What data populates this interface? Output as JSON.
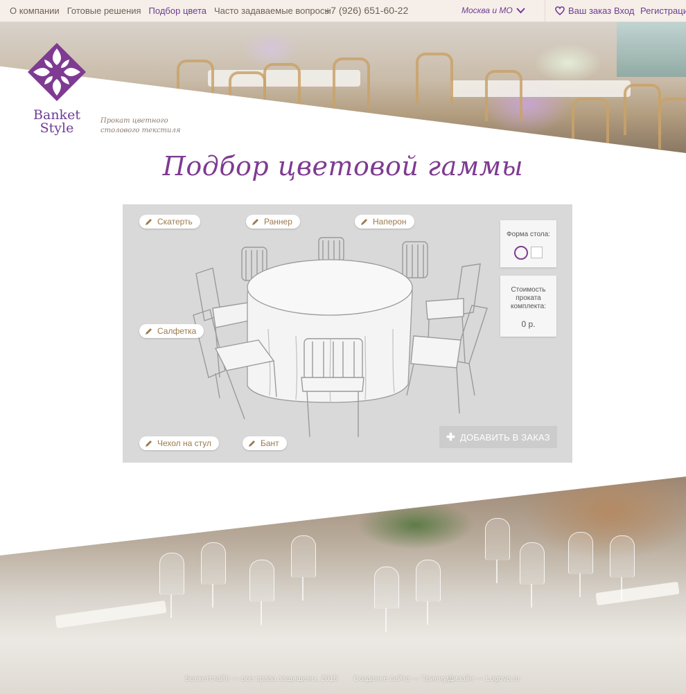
{
  "nav": {
    "items": [
      {
        "label": "О компании"
      },
      {
        "label": "Готовые решения"
      },
      {
        "label": "Подбор цвета",
        "active": true
      },
      {
        "label": "Часто задаваемые вопросы"
      }
    ],
    "phone": "+7 (926) 651-60-22",
    "city": "Москва и МО",
    "order": "Ваш заказ",
    "login": "Вход",
    "register": "Регистрация"
  },
  "brand": {
    "name_line1": "Banket",
    "name_line2": "Style",
    "tagline_line1": "Прокат цветного",
    "tagline_line2": "столового текстиля"
  },
  "page": {
    "title": "Подбор цветовой гаммы"
  },
  "configurator": {
    "items": {
      "tablecloth": "Скатерть",
      "runner": "Раннер",
      "naperon": "Наперон",
      "napkin": "Салфетка",
      "chair_cover": "Чехол на стул",
      "bow": "Бант"
    },
    "shape_label": "Форма стола:",
    "price_label_line1": "Стоимость",
    "price_label_line2": "проката",
    "price_label_line3": "комплекта:",
    "price_value": "0 р.",
    "add_to_order": "ДОБАВИТЬ В ЗАКАЗ"
  },
  "footer": {
    "copyright": "Банкетстайл — все права защищены, 2015",
    "development": "Создание сайта — Триниум",
    "design": "Дизайн — Logovo.ru"
  },
  "colors": {
    "accent": "#7e3b91",
    "gold_text": "#9a7a4c",
    "panel_bg": "#d9d9d9"
  }
}
